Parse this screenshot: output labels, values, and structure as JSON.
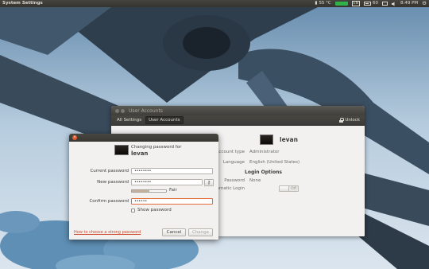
{
  "panel": {
    "app_title": "System Settings",
    "temperature": "55 °C",
    "keyboard_layout": "EN",
    "battery_percent": "60",
    "time": "8:49 PM"
  },
  "accounts_window": {
    "title": "User Accounts",
    "toolbar": {
      "all_settings": "All Settings",
      "current": "User Accounts",
      "unlock": "Unlock"
    },
    "username": "levan",
    "rows": [
      {
        "label": "Account type",
        "value": "Administrator"
      },
      {
        "label": "Language",
        "value": "English (United States)"
      }
    ],
    "login_options_heading": "Login Options",
    "password_label": "Password",
    "password_value": "None",
    "autologin_label": "Automatic Login",
    "autologin_state": "Off"
  },
  "password_dialog": {
    "heading": "Changing password for",
    "username": "levan",
    "current_label": "Current password",
    "current_value": "••••••••",
    "new_label": "New password",
    "new_value": "••••••••",
    "strength_text": "Fair",
    "strength_fraction": 0.5,
    "confirm_label": "Confirm password",
    "confirm_value": "••••••",
    "show_password_label": "Show password",
    "help_link": "How to choose a strong password",
    "cancel_label": "Cancel",
    "change_label": "Change"
  },
  "colors": {
    "accent": "#e25b2a",
    "panel": "#3c3b37",
    "window_bg": "#f2f1f0"
  }
}
